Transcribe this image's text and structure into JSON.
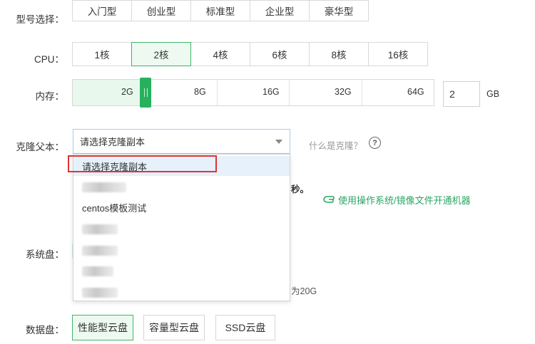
{
  "model": {
    "label": "型号选择：",
    "options": [
      "入门型",
      "创业型",
      "标准型",
      "企业型",
      "豪华型"
    ]
  },
  "cpu": {
    "label": "CPU：",
    "options": [
      "1核",
      "2核",
      "4核",
      "6核",
      "8核",
      "16核"
    ],
    "selected": "2核"
  },
  "memory": {
    "label": "内存：",
    "ticks": [
      "2G",
      "8G",
      "16G",
      "32G",
      "64G"
    ],
    "selected": "2G",
    "input_value": "2",
    "unit": "GB"
  },
  "clone": {
    "label": "克隆父本：",
    "selected_text": "请选择克隆副本",
    "help_text": "什么是克隆？",
    "help_icon": "question-circle-icon",
    "dropdown_items": [
      "请选择克隆副本",
      "",
      "centos模板测试",
      "",
      "",
      "",
      ""
    ]
  },
  "peek": {
    "text_seconds": "秒。",
    "link_text": "使用操作系统/镜像文件开通机器",
    "link_icon": "hand-pointer-icon",
    "text_disk_hint": "为20G"
  },
  "system_disk": {
    "label": "系统盘："
  },
  "data_disk": {
    "label": "数据盘：",
    "options": [
      "性能型云盘",
      "容量型云盘",
      "SSD云盘"
    ],
    "selected": "性能型云盘"
  },
  "colors": {
    "accent_green": "#27b15e",
    "highlight_red": "#e0332f",
    "selected_bg": "#eefaf1"
  }
}
